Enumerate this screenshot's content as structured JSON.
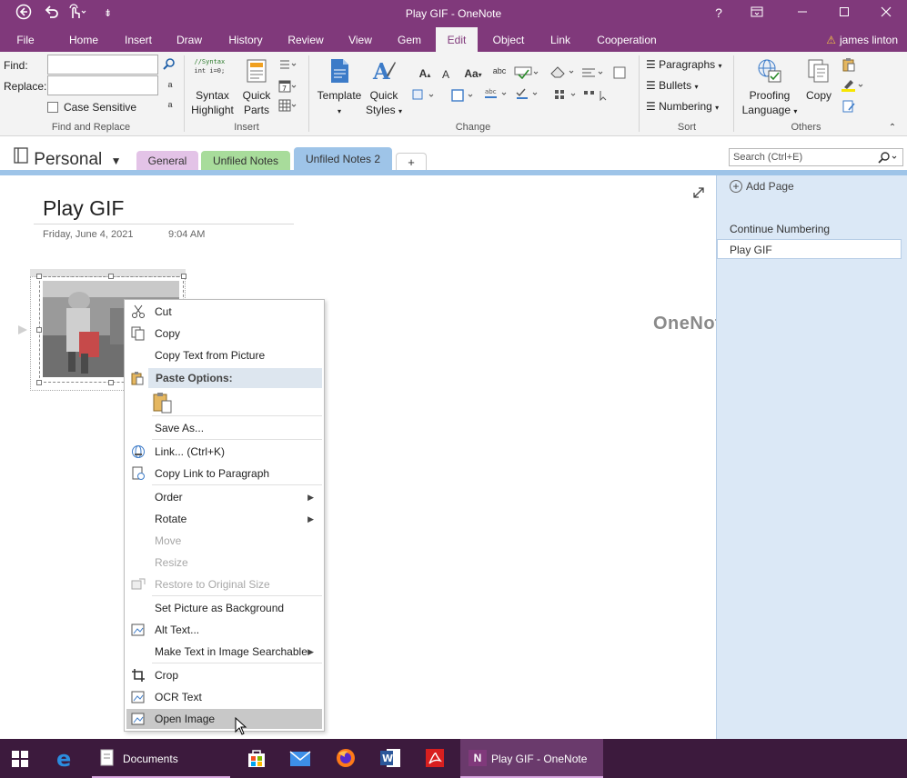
{
  "window": {
    "title": "Play GIF - OneNote",
    "help": "?",
    "qa_more": "⇟"
  },
  "tabs": [
    "File",
    "Home",
    "Insert",
    "Draw",
    "History",
    "Review",
    "View",
    "Gem",
    "Edit",
    "Object",
    "Link",
    "Cooperation"
  ],
  "active_tab": "Edit",
  "user": "james linton",
  "ribbon": {
    "find_label": "Find:",
    "replace_label": "Replace:",
    "case_sensitive": "Case Sensitive",
    "find_replace_group": "Find and Replace",
    "syntax_sample_1": "//Syntax",
    "syntax_sample_2": "int i=0;",
    "syntax_highlight_1": "Syntax",
    "syntax_highlight_2": "Highlight",
    "quick_parts_1": "Quick",
    "quick_parts_2": "Parts",
    "insert_group": "Insert",
    "template": "Template",
    "quick_styles_1": "Quick",
    "quick_styles_2": "Styles",
    "aa": "Aa",
    "abc": "abc",
    "change_group": "Change",
    "paragraphs": "Paragraphs",
    "bullets": "Bullets",
    "numbering": "Numbering",
    "sort_group": "Sort",
    "proofing_1": "Proofing",
    "proofing_2": "Language",
    "copy": "Copy",
    "others_group": "Others"
  },
  "notebook": {
    "name": "Personal",
    "sections": [
      {
        "label": "General",
        "color": "#e3c3e7"
      },
      {
        "label": "Unfiled Notes",
        "color": "#a8dc9b"
      },
      {
        "label": "Unfiled Notes 2",
        "color": "#9ec4e8"
      }
    ],
    "add_section": "+",
    "search_placeholder": "Search (Ctrl+E)"
  },
  "page": {
    "title": "Play GIF",
    "date": "Friday, June 4, 2021",
    "time": "9:04 AM",
    "watermark": "OneNoteGem.com"
  },
  "pages_pane": {
    "add_page": "Add Page",
    "continue_numbering": "Continue Numbering",
    "pages": [
      "Play GIF"
    ]
  },
  "context_menu": {
    "cut": "Cut",
    "copy": "Copy",
    "copy_text": "Copy Text from Picture",
    "paste_options": "Paste Options:",
    "save_as": "Save As...",
    "link": "Link...  (Ctrl+K)",
    "copy_link": "Copy Link to Paragraph",
    "order": "Order",
    "rotate": "Rotate",
    "move": "Move",
    "resize": "Resize",
    "restore": "Restore to Original Size",
    "set_background": "Set Picture as Background",
    "alt_text": "Alt Text...",
    "make_searchable": "Make Text in Image Searchable",
    "crop": "Crop",
    "ocr": "OCR Text",
    "open_image": "Open Image"
  },
  "taskbar": {
    "documents": "Documents",
    "onenote": "Play GIF - OneNote",
    "onenote_badge": "N"
  },
  "colors": {
    "accent": "#80397b",
    "taskbar": "#3c1a3d",
    "menu_highlight": "#c8c8c8"
  }
}
